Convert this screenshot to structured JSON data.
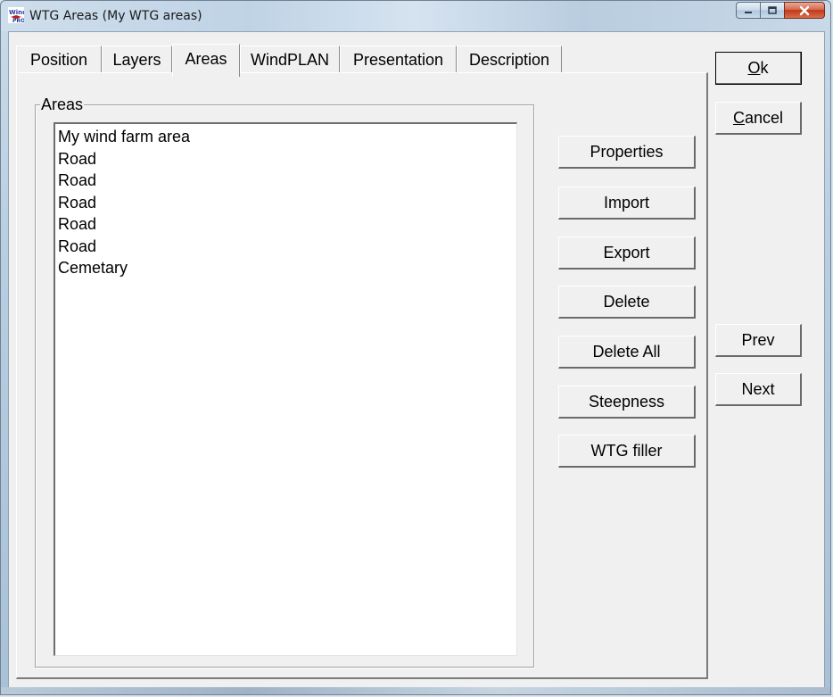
{
  "window": {
    "title": "WTG Areas  (My WTG areas)",
    "icon": "windpro-app-icon",
    "controls": [
      "minimize-icon",
      "maximize-icon",
      "close-icon"
    ]
  },
  "tabs": [
    {
      "label": "Position",
      "active": false
    },
    {
      "label": "Layers",
      "active": false
    },
    {
      "label": "Areas",
      "active": true
    },
    {
      "label": "WindPLAN",
      "active": false
    },
    {
      "label": "Presentation",
      "active": false
    },
    {
      "label": "Description",
      "active": false
    }
  ],
  "areas_group": {
    "label": "Areas",
    "items": [
      "My wind farm area",
      "Road",
      "Road",
      "Road",
      "Road",
      "Road",
      "Cemetary"
    ]
  },
  "area_buttons": {
    "properties": "Properties",
    "import": "Import",
    "export": "Export",
    "delete": "Delete",
    "delete_all": "Delete All",
    "steepness": "Steepness",
    "wtg_filler": "WTG filler"
  },
  "dialog_buttons": {
    "ok": {
      "accel": "O",
      "rest": "k"
    },
    "cancel": {
      "accel": "C",
      "rest": "ancel"
    },
    "prev": "Prev",
    "next": "Next"
  }
}
